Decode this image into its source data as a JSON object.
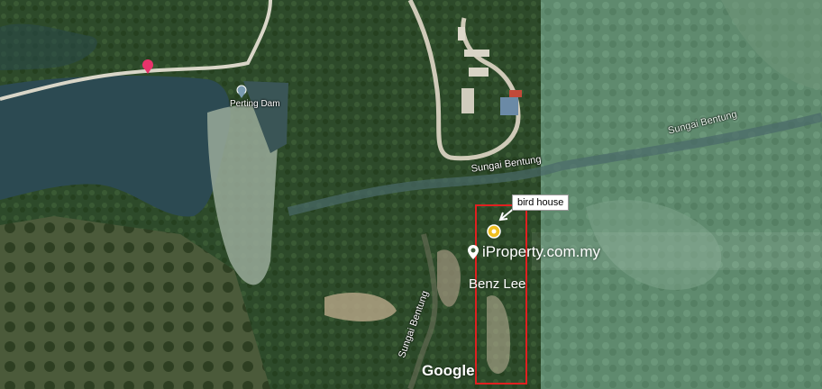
{
  "map": {
    "places": {
      "dam": "Perting Dam",
      "river_1": "Sungai Bentung",
      "river_2": "Sungai Bentung",
      "river_3": "Sungai Bentung"
    },
    "annotation": {
      "callout": "bird house"
    },
    "watermark": {
      "brand": "iProperty.com.my",
      "agent": "Benz Lee"
    },
    "attribution": "Google",
    "colors": {
      "water": "#2c4a52",
      "forest": "#2f4a2c",
      "highlight": "#e02020",
      "pin": "#e8336b"
    }
  }
}
